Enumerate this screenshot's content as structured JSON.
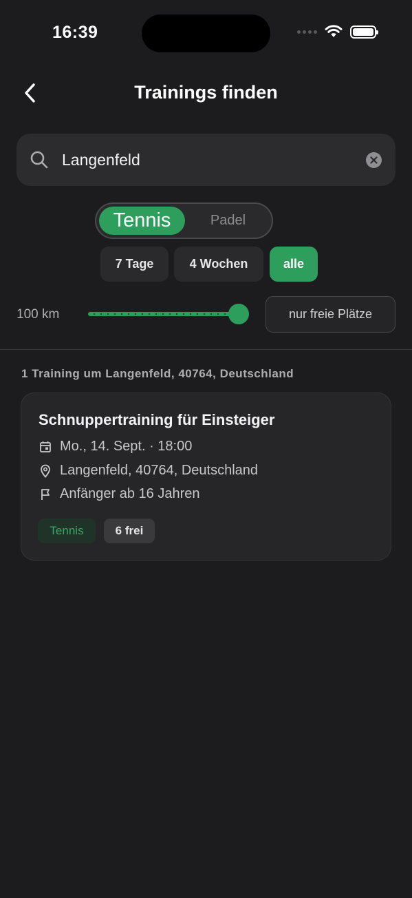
{
  "status_bar": {
    "time": "16:39"
  },
  "nav": {
    "title": "Trainings finden",
    "back_icon": "chevron-left-icon"
  },
  "search": {
    "value": "Langenfeld",
    "icon": "search-icon",
    "clear_icon": "clear-icon"
  },
  "sport_toggle": {
    "options": [
      "Tennis",
      "Padel"
    ],
    "selected": "Tennis"
  },
  "time_filter": {
    "options": [
      "7 Tage",
      "4 Wochen",
      "alle"
    ],
    "selected": "alle"
  },
  "distance": {
    "label": "100 km",
    "value_fraction": 1.0
  },
  "free_only_button": "nur freie Plätze",
  "results": {
    "count_text": "1 Training um Langenfeld, 40764, Deutschland",
    "items": [
      {
        "title": "Schnuppertraining für Einsteiger",
        "date": "Mo., 14. Sept. · 18:00",
        "location": "Langenfeld, 40764, Deutschland",
        "level": "Anfänger ab 16 Jahren",
        "sport_tag": "Tennis",
        "free_tag": "6 frei"
      }
    ]
  },
  "colors": {
    "accent": "#2e9e5c",
    "background": "#1c1c1e",
    "surface": "#2c2c2e"
  }
}
